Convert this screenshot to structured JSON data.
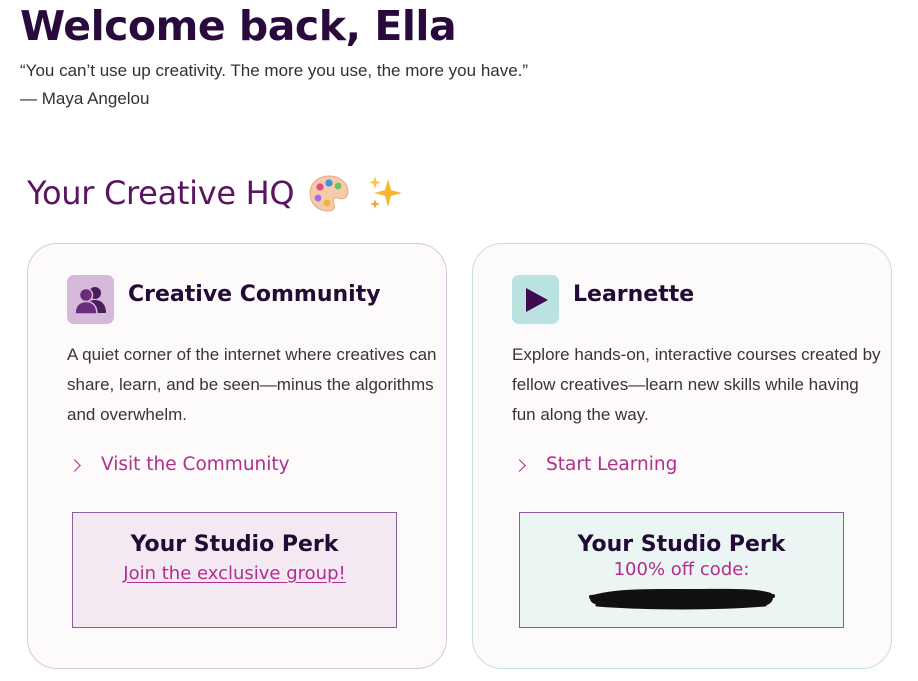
{
  "header": {
    "welcome": "Welcome back, Ella",
    "quote": "“You can’t use up creativity. The more you use, the more you have.”",
    "author": "— Maya Angelou"
  },
  "section": {
    "title": "Your Creative HQ",
    "emojis": [
      "artist-palette-icon",
      "sparkles-icon"
    ]
  },
  "cards": [
    {
      "icon": "community-people-icon",
      "title": "Creative Community",
      "description": "A quiet corner of the internet where creatives can share, learn, and be seen—minus the algorithms and overwhelm.",
      "link_label": "Visit the Community",
      "perk_title": "Your Studio Perk",
      "perk_link": "Join the exclusive group!"
    },
    {
      "icon": "play-icon",
      "title": "Learnette",
      "description": "Explore hands-on, interactive courses created by fellow creatives—learn new skills while having fun along the way.",
      "link_label": "Start Learning",
      "perk_title": "Your Studio Perk",
      "perk_code_label": "100% off code:"
    }
  ],
  "colors": {
    "heading": "#2a0a3d",
    "section_title": "#5a1560",
    "accent_link": "#b02e8c",
    "community_icon_bg": "#d6b8d8",
    "learn_icon_bg": "#b9e2e0",
    "perk_border": "#8a5e9c"
  }
}
